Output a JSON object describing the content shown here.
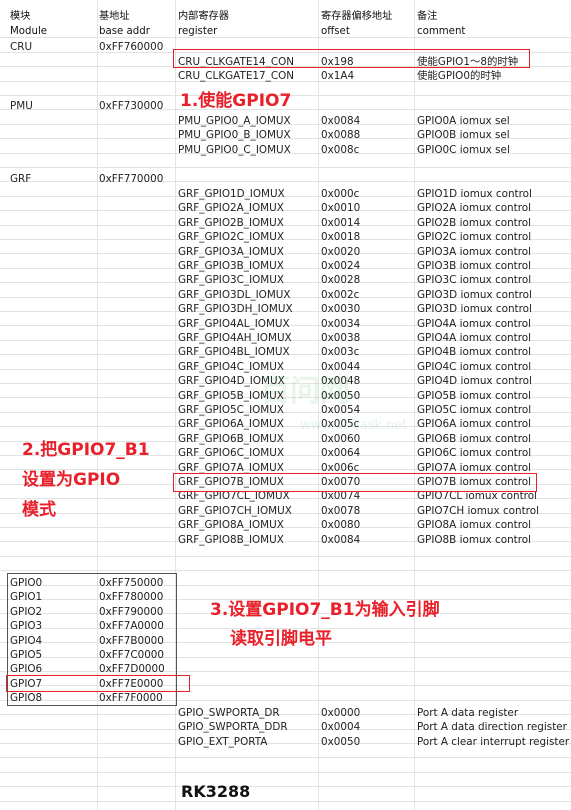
{
  "header": {
    "cn": [
      "模块",
      "基地址",
      "内部寄存器",
      "寄存器偏移地址",
      "备注"
    ],
    "en": [
      "Module",
      "base addr",
      "register",
      "offset",
      "comment"
    ]
  },
  "cru": {
    "module": "CRU",
    "base": "0xFF760000",
    "rows": [
      [
        "CRU_CLKGATE14_CON",
        "0x198",
        "使能GPIO1～8的时钟"
      ],
      [
        "CRU_CLKGATE17_CON",
        "0x1A4",
        "使能GPIO0的时钟"
      ]
    ]
  },
  "pmu": {
    "module": "PMU",
    "base": "0xFF730000",
    "rows": [
      [
        "PMU_GPIO0_A_IOMUX",
        "0x0084",
        "GPIO0A iomux sel"
      ],
      [
        "PMU_GPIO0_B_IOMUX",
        "0x0088",
        "GPIO0B iomux sel"
      ],
      [
        "PMU_GPIO0_C_IOMUX",
        "0x008c",
        "GPIO0C iomux sel"
      ]
    ]
  },
  "grf": {
    "module": "GRF",
    "base": "0xFF770000",
    "rows": [
      [
        "GRF_GPIO1D_IOMUX",
        "0x000c",
        "GPIO1D iomux control"
      ],
      [
        "GRF_GPIO2A_IOMUX",
        "0x0010",
        "GPIO2A iomux control"
      ],
      [
        "GRF_GPIO2B_IOMUX",
        "0x0014",
        "GPIO2B iomux control"
      ],
      [
        "GRF_GPIO2C_IOMUX",
        "0x0018",
        "GPIO2C iomux control"
      ],
      [
        "GRF_GPIO3A_IOMUX",
        "0x0020",
        "GPIO3A iomux control"
      ],
      [
        "GRF_GPIO3B_IOMUX",
        "0x0024",
        "GPIO3B iomux control"
      ],
      [
        "GRF_GPIO3C_IOMUX",
        "0x0028",
        "GPIO3C iomux control"
      ],
      [
        "GRF_GPIO3DL_IOMUX",
        "0x002c",
        "GPIO3D iomux control"
      ],
      [
        "GRF_GPIO3DH_IOMUX",
        "0x0030",
        "GPIO3D iomux control"
      ],
      [
        "GRF_GPIO4AL_IOMUX",
        "0x0034",
        "GPIO4A iomux control"
      ],
      [
        "GRF_GPIO4AH_IOMUX",
        "0x0038",
        "GPIO4A iomux control"
      ],
      [
        "GRF_GPIO4BL_IOMUX",
        "0x003c",
        "GPIO4B iomux control"
      ],
      [
        "GRF_GPIO4C_IOMUX",
        "0x0044",
        "GPIO4C iomux control"
      ],
      [
        "GRF_GPIO4D_IOMUX",
        "0x0048",
        "GPIO4D iomux control"
      ],
      [
        "GRF_GPIO5B_IOMUX",
        "0x0050",
        "GPIO5B iomux control"
      ],
      [
        "GRF_GPIO5C_IOMUX",
        "0x0054",
        "GPIO5C iomux control"
      ],
      [
        "GRF_GPIO6A_IOMUX",
        "0x005c",
        "GPIO6A iomux control"
      ],
      [
        "GRF_GPIO6B_IOMUX",
        "0x0060",
        "GPIO6B iomux control"
      ],
      [
        "GRF_GPIO6C_IOMUX",
        "0x0064",
        "GPIO6C iomux control"
      ],
      [
        "GRF_GPIO7A_IOMUX",
        "0x006c",
        "GPIO7A iomux control"
      ],
      [
        "GRF_GPIO7B_IOMUX",
        "0x0070",
        "GPIO7B iomux control"
      ],
      [
        "GRF_GPIO7CL_IOMUX",
        "0x0074",
        "GPIO7CL iomux control"
      ],
      [
        "GRF_GPIO7CH_IOMUX",
        "0x0078",
        "GPIO7CH iomux control"
      ],
      [
        "GRF_GPIO8A_IOMUX",
        "0x0080",
        "GPIO8A iomux control"
      ],
      [
        "GRF_GPIO8B_IOMUX",
        "0x0084",
        "GPIO8B iomux control"
      ]
    ]
  },
  "gpio_bases": [
    [
      "GPIO0",
      "0xFF750000"
    ],
    [
      "GPIO1",
      "0xFF780000"
    ],
    [
      "GPIO2",
      "0xFF790000"
    ],
    [
      "GPIO3",
      "0xFF7A0000"
    ],
    [
      "GPIO4",
      "0xFF7B0000"
    ],
    [
      "GPIO5",
      "0xFF7C0000"
    ],
    [
      "GPIO6",
      "0xFF7D0000"
    ],
    [
      "GPIO7",
      "0xFF7E0000"
    ],
    [
      "GPIO8",
      "0xFF7F0000"
    ]
  ],
  "gpio_regs": [
    [
      "GPIO_SWPORTA_DR",
      "0x0000",
      "Port A data register"
    ],
    [
      "GPIO_SWPORTA_DDR",
      "0x0004",
      "Port A data direction register"
    ],
    [
      "GPIO_EXT_PORTA",
      "0x0050",
      "Port A clear interrupt register"
    ]
  ],
  "annotations": {
    "step1": "1.使能GPIO7",
    "step2": [
      "2.把GPIO7_B1",
      "设置为GPIO",
      "模式"
    ],
    "step3": [
      "3.设置GPIO7_B1为输入引脚",
      "读取引脚电平"
    ]
  },
  "footer_title": "RK3288",
  "watermark": {
    "main": "百问网",
    "sub": "www.100ask.net"
  },
  "colors": {
    "annotation_red": "#e8202a",
    "grid": "#e3e3e3"
  }
}
